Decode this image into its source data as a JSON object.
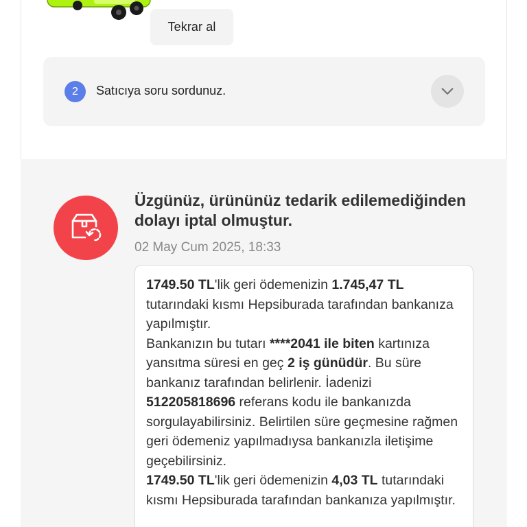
{
  "reorder": {
    "label": "Tekrar al"
  },
  "question": {
    "step": "2",
    "text": "Satıcıya soru sordunuz."
  },
  "cancellation": {
    "title": "Üzgünüz, ürününüz tedarik edilemediğinden dolayı iptal olmuştur.",
    "date": "02 May Cum 2025, 18:33"
  },
  "refund": {
    "p1": {
      "amount_total": "1749.50 TL",
      "t1": "'lik geri ödemenizin ",
      "amount_part": "1.745,47 TL",
      "t2": " tutarındaki kısmı Hepsiburada tarafından bankanıza yapılmıştır."
    },
    "p2": {
      "t1": "Bankanızın bu tutarı ",
      "card": "****2041 ile biten",
      "t2": " kartınıza yansıtma süresi en geç ",
      "duration": "2 iş günüdür",
      "t3": ". Bu süre bankanız tarafından belirlenir. İadenizi ",
      "reference": "512205818696",
      "t4": " referans kodu ile bankanızda sorgulayabilirsiniz. Belirtilen süre geçmesine rağmen geri ödemeniz yapılmadıysa bankanızla iletişime geçebilirsiniz."
    },
    "p3": {
      "amount_total": "1749.50 TL",
      "t1": "'lik geri ödemenizin ",
      "amount_part": "4,03 TL",
      "t2": " tutarındaki kısmı Hepsiburada tarafından bankanıza yapılmıştır."
    }
  },
  "icons": {
    "product": "green-scooter-image",
    "chevron": "chevron-down-icon",
    "cancel": "package-return-icon"
  },
  "colors": {
    "badge": "#5b7ee8",
    "cancel_circle": "#f3434a"
  }
}
